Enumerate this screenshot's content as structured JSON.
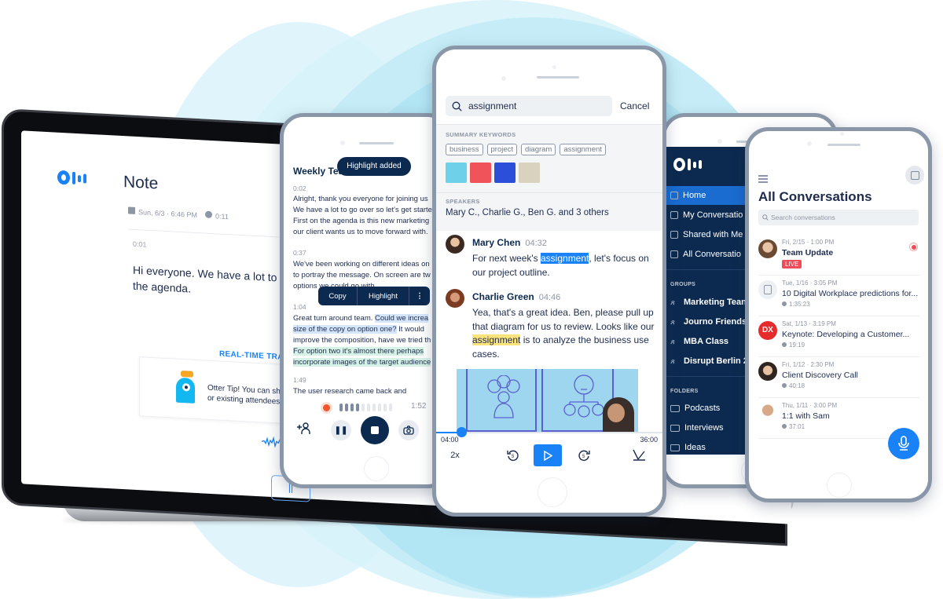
{
  "laptop": {
    "note_title": "Note",
    "date": "Sun, 6/3 · 6:46 PM",
    "duration": "0:11",
    "timestamp": "0:01",
    "transcript_line1": "Hi everyone. We have a lot to cover t",
    "transcript_line2": "the agenda.",
    "realtime_label": "REAL-TIME TRANSC",
    "tip_line1": "Otter Tip! You can share this",
    "tip_line2": "or existing attendees.",
    "pause_label": "||"
  },
  "phone_recording": {
    "title": "Weekly Tea",
    "toast": "Highlight added",
    "blocks": [
      {
        "ts": "0:02",
        "lines": [
          "Alright, thank you everyone for joining us",
          "We have a lot to go over so let's get starte",
          "First on the agenda is this new marketing",
          "our client wants us to move forward with."
        ]
      },
      {
        "ts": "0:37",
        "lines": [
          "We've been working on different ideas on",
          "to portray the message. On screen are tw",
          "options we could go with."
        ]
      },
      {
        "ts": "1:04",
        "plain1": "Great turn around team. ",
        "sel1": "Could we increa",
        "sel2": "size of the copy on option one?",
        "plain2": " It would",
        "line3": "improve the composition, have we tried th",
        "hl1": "For option two it's almost there perhaps",
        "hl2": "incorporate images of the target audience"
      },
      {
        "ts": "1:49",
        "lines": [
          "The user research came back and"
        ]
      }
    ],
    "context_menu": {
      "copy": "Copy",
      "highlight": "Highlight",
      "more": "⋮"
    },
    "record_level": 0.4,
    "record_time": "1:52",
    "add_person": "+𝑅"
  },
  "phone_search": {
    "query": "assignment",
    "cancel": "Cancel",
    "summary_label": "SUMMARY KEYWORDS",
    "keywords": [
      "business",
      "project",
      "diagram",
      "assignment"
    ],
    "thumb_colors": [
      "#6fd0ea",
      "#f0545a",
      "#2b4fd8",
      "#d9d2bf"
    ],
    "speakers_label": "SPEAKERS",
    "speakers": "Mary C., Charlie G., Ben G. and 3 others",
    "messages": [
      {
        "name": "Mary Chen",
        "time": "04:32",
        "pre": "For next week's ",
        "hit": "assignment",
        "post": ", let's focus on our project outline."
      },
      {
        "name": "Charlie Green",
        "time": "04:46",
        "pre": "Yea, that's a great idea. Ben, please pull up that diagram for us to review. Looks like our ",
        "hit": "assignment",
        "post": " is to analyze the business use cases."
      }
    ],
    "progress": 0.111,
    "elapsed": "04:00",
    "total": "36:00",
    "speed": "2x"
  },
  "phone_sidebar": {
    "nav": [
      "Home",
      "My Conversatio",
      "Shared with Me",
      "All Conversatio"
    ],
    "groups_label": "GROUPS",
    "groups": [
      "Marketing Tean",
      "Journo Friends",
      "MBA Class",
      "Disrupt Berlin 2"
    ],
    "folders_label": "FOLDERS",
    "folders": [
      "Podcasts",
      "Interviews",
      "Ideas"
    ]
  },
  "phone_list": {
    "title": "All Conversations",
    "search_placeholder": "Search conversations",
    "items": [
      {
        "date": "Fri, 2/15 · 1:00 PM",
        "title": "Team Update",
        "badge": "LIVE"
      },
      {
        "date": "Tue, 1/16 · 3:05 PM",
        "title": "10 Digital Workplace predictions for...",
        "duration": "1:35:23"
      },
      {
        "date": "Sat, 1/13 · 3:19 PM",
        "title": "Keynote: Developing a Customer...",
        "duration": "19:19",
        "avatar_text": "DX"
      },
      {
        "date": "Fri, 1/12 · 2:30 PM",
        "title": "Client Discovery Call",
        "duration": "40:18"
      },
      {
        "date": "Thu, 1/11 · 3:00 PM",
        "title": "1:1 with Sam",
        "duration": "37:01"
      }
    ]
  },
  "colors": {
    "brand_blue": "#1a82f7",
    "navy": "#0c2a4f",
    "live_red": "#ef4b58",
    "highlight_yellow": "#fde47a"
  }
}
